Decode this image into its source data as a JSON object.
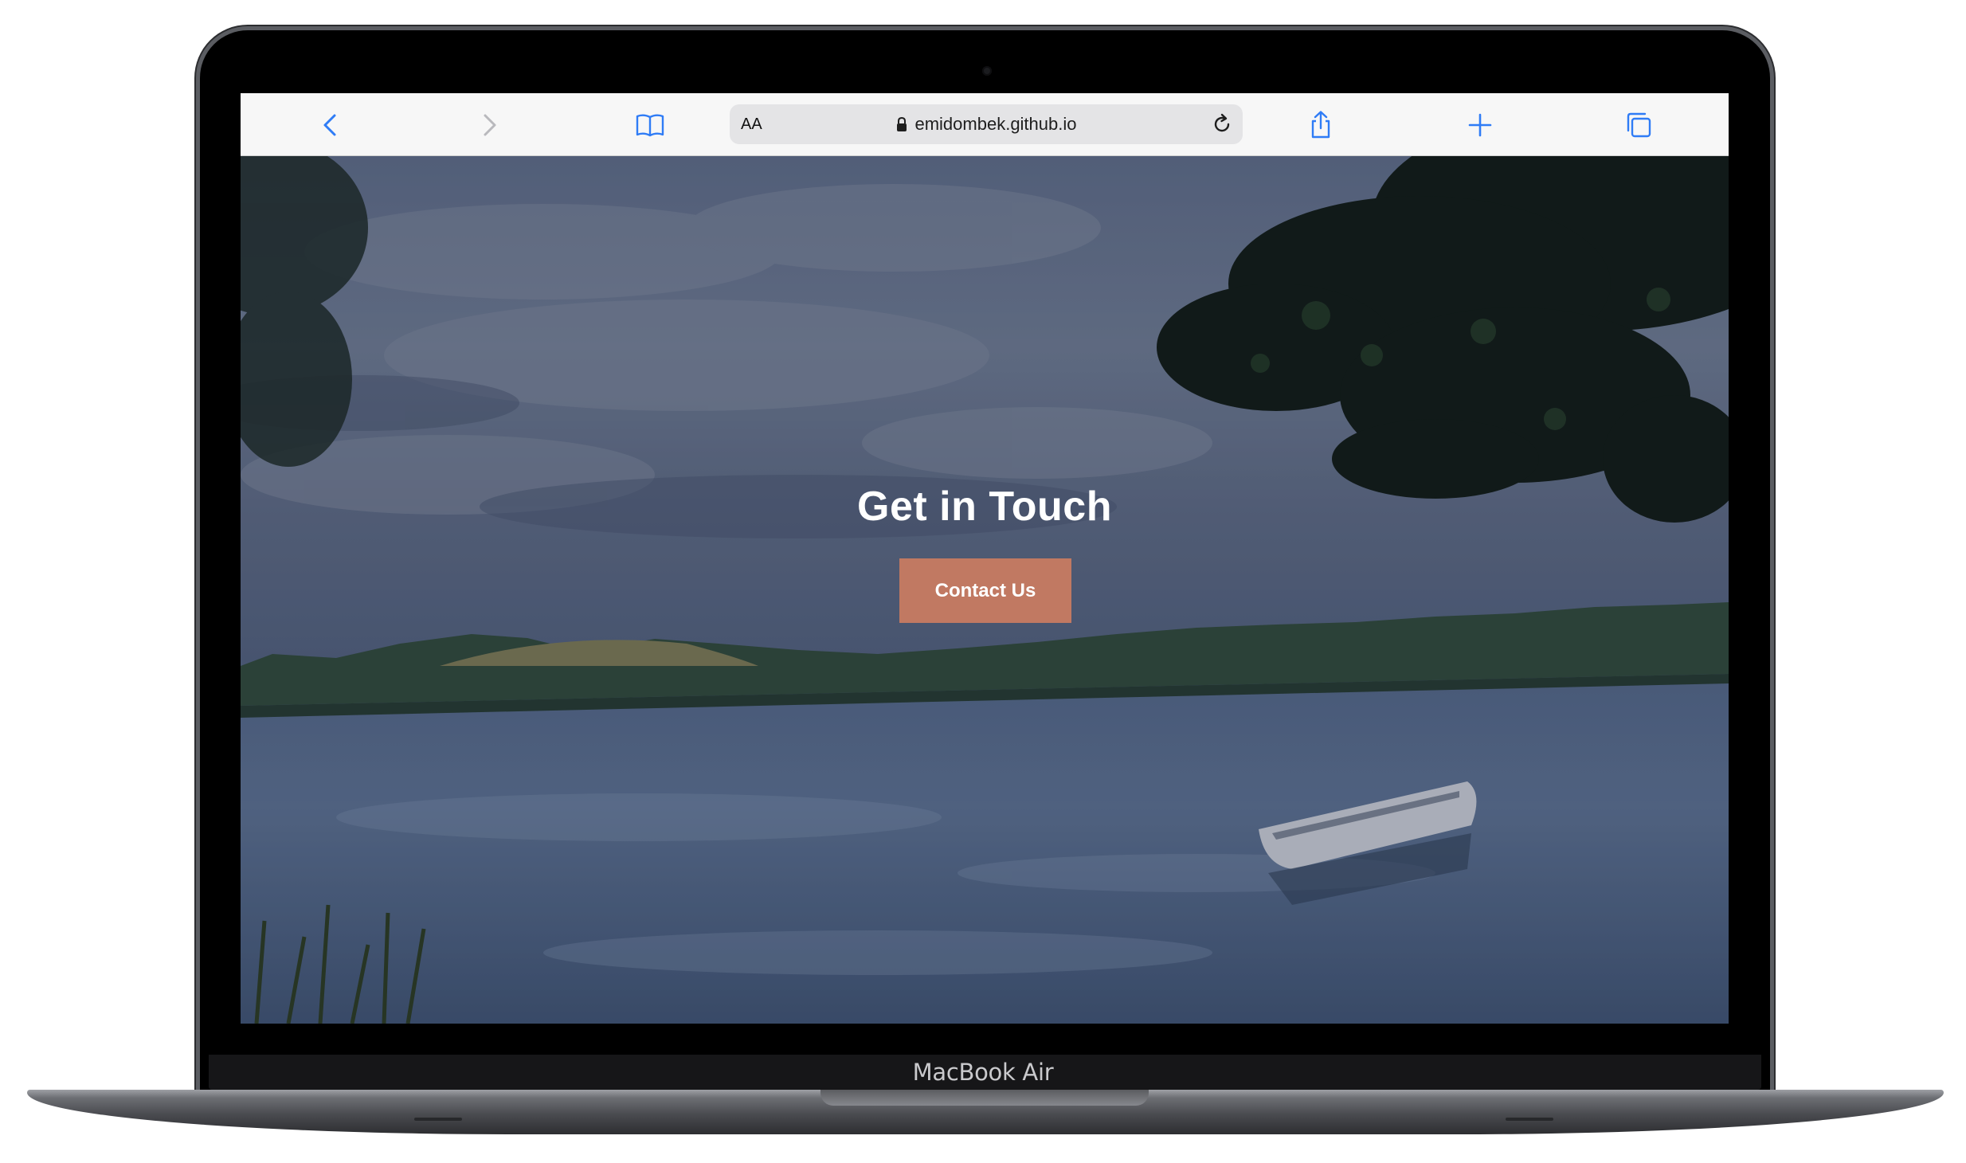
{
  "device": {
    "label": "MacBook Air"
  },
  "browser": {
    "text_size_label": "AA",
    "url": "emidombek.github.io",
    "icons": {
      "back": "chevron-left-icon",
      "forward": "chevron-right-icon",
      "bookmarks": "book-icon",
      "lock": "lock-icon",
      "reload": "reload-icon",
      "share": "share-icon",
      "new_tab": "plus-icon",
      "tabs": "tabs-icon"
    },
    "accent_color": "#2f7cf6"
  },
  "hero": {
    "title": "Get in Touch",
    "cta_label": "Contact Us",
    "cta_color": "#c17962"
  }
}
